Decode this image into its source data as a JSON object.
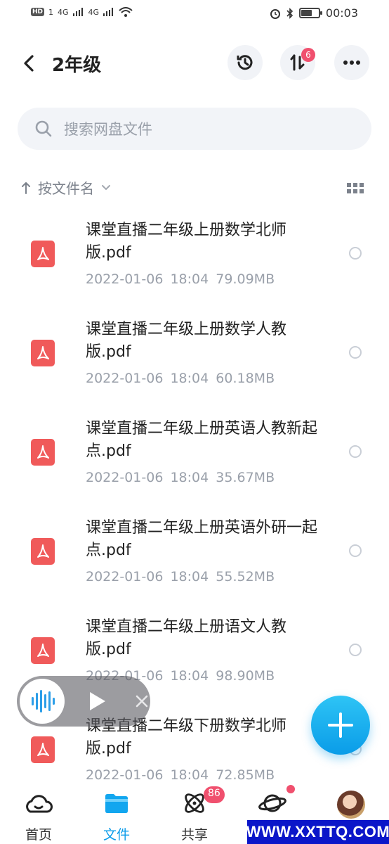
{
  "status_bar": {
    "left_badge": "HD",
    "left_sim": "1",
    "signal1": "4G",
    "signal2": "4G",
    "time": "00:03",
    "icons": [
      "alarm-icon",
      "bluetooth-icon",
      "battery-icon"
    ]
  },
  "header": {
    "title": "2年级",
    "transfer_badge": "6"
  },
  "search": {
    "placeholder": "搜索网盘文件"
  },
  "sort": {
    "label": "按文件名"
  },
  "files": [
    {
      "name": "课堂直播二年级上册数学北师版.pdf",
      "date": "2022-01-06",
      "time": "18:04",
      "size": "79.09MB"
    },
    {
      "name": "课堂直播二年级上册数学人教版.pdf",
      "date": "2022-01-06",
      "time": "18:04",
      "size": "60.18MB"
    },
    {
      "name": "课堂直播二年级上册英语人教新起点.pdf",
      "date": "2022-01-06",
      "time": "18:04",
      "size": "35.67MB"
    },
    {
      "name": "课堂直播二年级上册英语外研一起点.pdf",
      "date": "2022-01-06",
      "time": "18:04",
      "size": "55.52MB"
    },
    {
      "name": "课堂直播二年级上册语文人教版.pdf",
      "date": "2022-01-06",
      "time": "18:04",
      "size": "98.90MB"
    },
    {
      "name": "课堂直播二年级下册数学北师版.pdf",
      "date": "2022-01-06",
      "time": "18:04",
      "size": "72.85MB"
    }
  ],
  "bottom_nav": {
    "items": [
      {
        "label": "首页",
        "icon": "cloud-home-icon"
      },
      {
        "label": "文件",
        "icon": "folder-icon",
        "active": true
      },
      {
        "label": "共享",
        "icon": "atom-icon",
        "badge": "86"
      },
      {
        "label": "",
        "icon": "planet-icon",
        "dot": true
      },
      {
        "label": "",
        "icon": "avatar"
      }
    ]
  },
  "watermark": "WWW.XXTTQ.COM",
  "colors": {
    "accent": "#0b9cea",
    "badge": "#f0506e",
    "pdf": "#f05a5a",
    "muted": "#9aa0aa"
  }
}
